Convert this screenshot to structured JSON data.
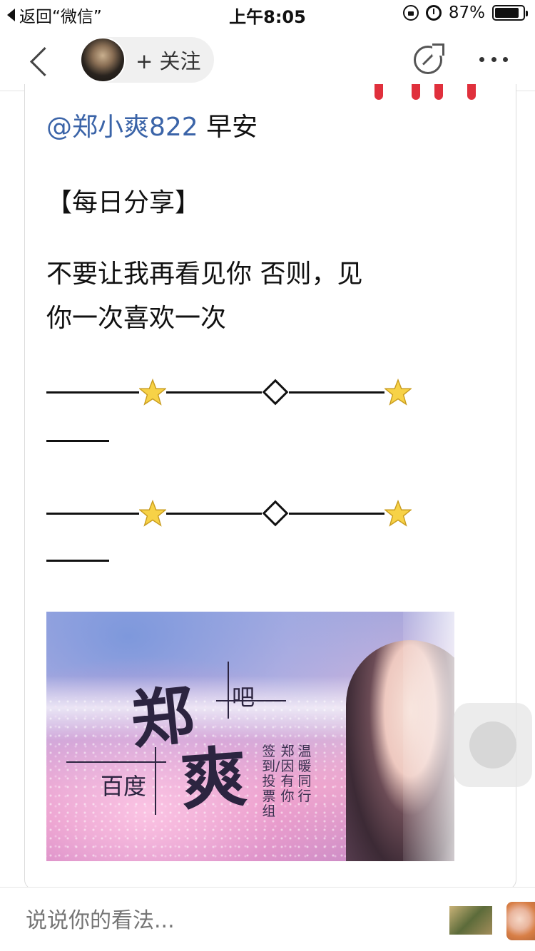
{
  "status_bar": {
    "back_label": "返回“微信”",
    "time": "上午8:05",
    "battery": "87%"
  },
  "nav": {
    "follow_label": "+ 关注"
  },
  "post": {
    "mention": "@郑小爽822",
    "greeting": " 早安",
    "heading": "【每日分享】",
    "body_line1": "不要让我再看见你 否则，见",
    "body_line2": "你一次喜欢一次"
  },
  "banner": {
    "big_char_1": "郑",
    "big_char_2": "爽",
    "word_ba": "吧",
    "word_baidu": "百度",
    "col_1": "签到/投票组",
    "col_2": "郑因有你",
    "col_3": "温暖同行"
  },
  "bottom": {
    "comment_placeholder": "说说你的看法..."
  },
  "colors": {
    "mention": "#3b64a8",
    "accent_red": "#e0303c"
  },
  "icons": [
    "back-chevron-icon",
    "share-icon",
    "more-icon",
    "star-icon",
    "diamond-icon",
    "lock-icon",
    "alarm-icon",
    "battery-icon"
  ]
}
